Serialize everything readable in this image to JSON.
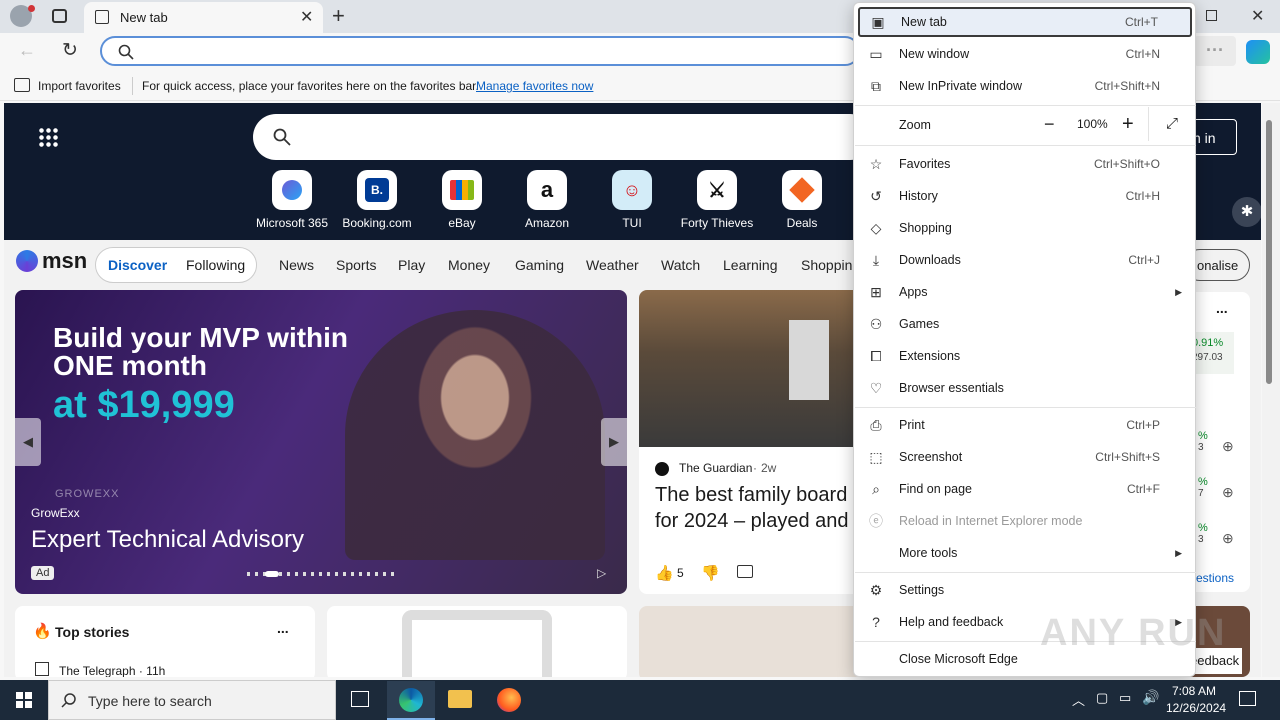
{
  "tab": {
    "title": "New tab"
  },
  "favbar": {
    "import_label": "Import favorites",
    "hint": "For quick access, place your favorites here on the favorites bar.",
    "manage_link": "Manage favorites now"
  },
  "quicklinks": [
    {
      "label": "Microsoft 365"
    },
    {
      "label": "Booking.com",
      "glyph": "B."
    },
    {
      "label": "eBay"
    },
    {
      "label": "Amazon",
      "glyph": "a"
    },
    {
      "label": "TUI"
    },
    {
      "label": "Forty Thieves"
    },
    {
      "label": "Deals"
    }
  ],
  "msn": {
    "logo": "msn",
    "discover": "Discover",
    "following": "Following",
    "nav": [
      "News",
      "Sports",
      "Play",
      "Money",
      "Gaming",
      "Weather",
      "Watch",
      "Learning",
      "Shopping"
    ],
    "personalise": "onalise",
    "signin": "n in"
  },
  "ad": {
    "line1": "Build your MVP within",
    "line2": "ONE month",
    "line3": "at $19,999",
    "brand": "GrowExx",
    "title": "Expert Technical Advisory",
    "badge": "Ad",
    "watermark": "GROWEXX"
  },
  "card2": {
    "source": "The Guardian",
    "age": "2w",
    "headline1": "The best family board",
    "headline2": "for 2024 – played and",
    "likes": "5"
  },
  "topstories": {
    "title": "Top stories",
    "more": "...",
    "source": "The Telegraph · 11h"
  },
  "side": {
    "more": "...",
    "pct": "0.91%",
    "val": "297.03",
    "r1": "%",
    "r1b": "3",
    "r2": "%",
    "r2b": "7",
    "r3": "%",
    "r3b": "3",
    "suggestions": "estions",
    "feedback": "eedback"
  },
  "menu": {
    "items": [
      {
        "label": "New tab",
        "shortcut": "Ctrl+T",
        "icon": "new-tab-icon"
      },
      {
        "label": "New window",
        "shortcut": "Ctrl+N",
        "icon": "new-window-icon"
      },
      {
        "label": "New InPrivate window",
        "shortcut": "Ctrl+Shift+N",
        "icon": "inprivate-icon"
      },
      {
        "label": "Favorites",
        "shortcut": "Ctrl+Shift+O",
        "icon": "star-icon"
      },
      {
        "label": "History",
        "shortcut": "Ctrl+H",
        "icon": "history-icon"
      },
      {
        "label": "Shopping",
        "shortcut": "",
        "icon": "tag-icon"
      },
      {
        "label": "Downloads",
        "shortcut": "Ctrl+J",
        "icon": "download-icon"
      },
      {
        "label": "Apps",
        "shortcut": "",
        "icon": "apps-icon"
      },
      {
        "label": "Games",
        "shortcut": "",
        "icon": "gamepad-icon"
      },
      {
        "label": "Extensions",
        "shortcut": "",
        "icon": "puzzle-icon"
      },
      {
        "label": "Browser essentials",
        "shortcut": "",
        "icon": "heart-pulse-icon"
      },
      {
        "label": "Print",
        "shortcut": "Ctrl+P",
        "icon": "printer-icon"
      },
      {
        "label": "Screenshot",
        "shortcut": "Ctrl+Shift+S",
        "icon": "screenshot-icon"
      },
      {
        "label": "Find on page",
        "shortcut": "Ctrl+F",
        "icon": "find-icon"
      },
      {
        "label": "Reload in Internet Explorer mode",
        "shortcut": "",
        "icon": "ie-icon"
      },
      {
        "label": "More tools",
        "shortcut": "",
        "icon": ""
      },
      {
        "label": "Settings",
        "shortcut": "",
        "icon": "gear-icon"
      },
      {
        "label": "Help and feedback",
        "shortcut": "",
        "icon": "help-icon"
      },
      {
        "label": "Close Microsoft Edge",
        "shortcut": "",
        "icon": ""
      }
    ],
    "zoom_label": "Zoom",
    "zoom_value": "100%"
  },
  "taskbar": {
    "search_placeholder": "Type here to search",
    "time": "7:08 AM",
    "date": "12/26/2024"
  },
  "watermark": "ANY RUN"
}
